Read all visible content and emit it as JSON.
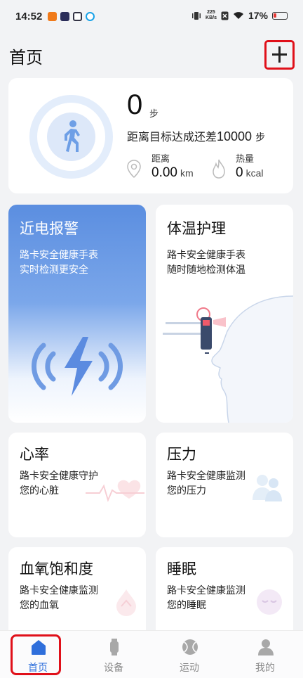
{
  "status_bar": {
    "time": "14:52",
    "net_speed_value": "225",
    "net_speed_unit": "KB/s",
    "battery": "17%"
  },
  "header": {
    "title": "首页",
    "add_icon": "plus-icon"
  },
  "steps": {
    "count": "0",
    "unit": "步",
    "goal_prefix": "距离目标达成还差",
    "goal_value": "10000",
    "goal_unit": "步",
    "distance_label": "距离",
    "distance_value": "0.00",
    "distance_unit": "km",
    "calories_label": "热量",
    "calories_value": "0",
    "calories_unit": "kcal"
  },
  "cards": {
    "alarm": {
      "title": "近电报警",
      "line1": "路卡安全健康手表",
      "line2": "实时检测更安全"
    },
    "temperature": {
      "title": "体温护理",
      "line1": "路卡安全健康手表",
      "line2": "随时随地检测体温"
    },
    "heart_rate": {
      "title": "心率",
      "line1": "路卡安全健康守护",
      "line2": "您的心脏"
    },
    "stress": {
      "title": "压力",
      "line1": "路卡安全健康监测",
      "line2": "您的压力"
    },
    "spo2": {
      "title": "血氧饱和度",
      "line1": "路卡安全健康监测",
      "line2": "您的血氧"
    },
    "sleep": {
      "title": "睡眠",
      "line1": "路卡安全健康监测",
      "line2": "您的睡眠"
    }
  },
  "nav": {
    "items": [
      {
        "label": "首页",
        "icon": "home-icon",
        "active": true
      },
      {
        "label": "设备",
        "icon": "watch-icon",
        "active": false
      },
      {
        "label": "运动",
        "icon": "ball-icon",
        "active": false
      },
      {
        "label": "我的",
        "icon": "person-icon",
        "active": false
      }
    ]
  },
  "colors": {
    "accent": "#2f6fdb",
    "highlight": "#e0101a",
    "alarm_card": "#5b8ee0"
  }
}
